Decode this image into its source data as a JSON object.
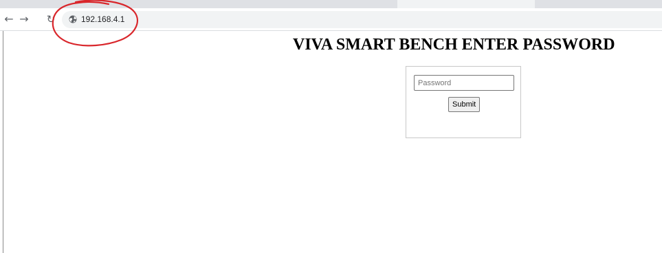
{
  "browser": {
    "url": "192.168.4.1",
    "back_icon": "arrow-left-icon",
    "forward_icon": "arrow-right-icon",
    "reload_icon": "reload-icon",
    "site_icon": "globe-icon"
  },
  "annotation": {
    "color": "#d9262b"
  },
  "page": {
    "title": "VIVA SMART BENCH ENTER PASSWORD",
    "password_placeholder": "Password",
    "submit_label": "Submit"
  }
}
